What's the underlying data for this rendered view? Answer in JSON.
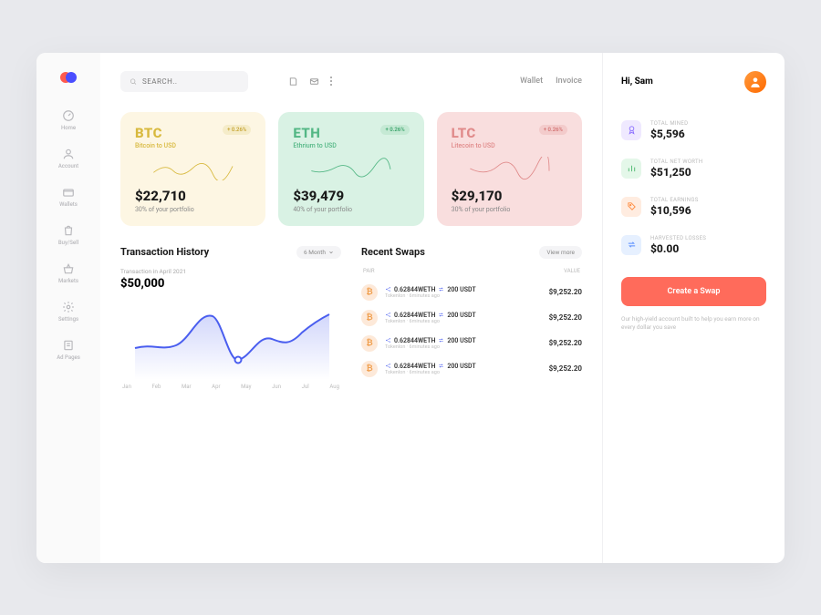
{
  "search": {
    "placeholder": "SEARCH.."
  },
  "nav": {
    "items": [
      {
        "label": "Home"
      },
      {
        "label": "Account"
      },
      {
        "label": "Wallets"
      },
      {
        "label": "Buy/Sell"
      },
      {
        "label": "Markets"
      },
      {
        "label": "Settings"
      },
      {
        "label": "Ad Pages"
      }
    ]
  },
  "top_links": {
    "wallet": "Wallet",
    "invoice": "Invoice"
  },
  "cards": [
    {
      "ticker": "BTC",
      "sub": "Bitcoin to USD",
      "change": "+ 0.26%",
      "price": "$22,710",
      "portfolio": "30% of your portfolio"
    },
    {
      "ticker": "ETH",
      "sub": "Ethrium to USD",
      "change": "+ 0.26%",
      "price": "$39,479",
      "portfolio": "40% of your portfolio"
    },
    {
      "ticker": "LTC",
      "sub": "Litecoin to USD",
      "change": "+ 0.26%",
      "price": "$29,170",
      "portfolio": "30% of your portfolio"
    }
  ],
  "history": {
    "title": "Transaction History",
    "range": "6 Month",
    "sub": "Transaction in April 2021",
    "value": "$50,000",
    "months": [
      "Jan",
      "Feb",
      "Mar",
      "Apr",
      "May",
      "Jun",
      "Jul",
      "Aug"
    ]
  },
  "swaps": {
    "title": "Recent Swaps",
    "more": "View more",
    "col_pair": "PAIR",
    "col_value": "VALUE",
    "rows": [
      {
        "pair_a": "0.62844WETH",
        "pair_b": "200 USDT",
        "sub": "Tokenlon · 6minutes ago",
        "value": "$9,252.20"
      },
      {
        "pair_a": "0.62844WETH",
        "pair_b": "200 USDT",
        "sub": "Tokenlon · 6minutes ago",
        "value": "$9,252.20"
      },
      {
        "pair_a": "0.62844WETH",
        "pair_b": "200 USDT",
        "sub": "Tokenlon · 6minutes ago",
        "value": "$9,252.20"
      },
      {
        "pair_a": "0.62844WETH",
        "pair_b": "200 USDT",
        "sub": "Tokenlon · 6minutes ago",
        "value": "$9,252.20"
      }
    ]
  },
  "right": {
    "greeting": "Hi, Sam",
    "stats": [
      {
        "label": "TOTAL MINED",
        "value": "$5,596"
      },
      {
        "label": "TOTAL NET WORTH",
        "value": "$51,250"
      },
      {
        "label": "TOTAL EARNINGS",
        "value": "$10,596"
      },
      {
        "label": "HARVESTED LOSSES",
        "value": "$0.00"
      }
    ],
    "cta": "Create a Swap",
    "cta_sub": "Our high-yield account built to help you earn more on every dollar you save"
  },
  "chart_data": {
    "type": "line",
    "title": "Transaction History",
    "xlabel": "",
    "ylabel": "",
    "x": [
      "Jan",
      "Feb",
      "Mar",
      "Apr",
      "May",
      "Jun",
      "Jul",
      "Aug"
    ],
    "values": [
      28000,
      30000,
      26000,
      52000,
      20000,
      38000,
      34000,
      48000
    ],
    "highlight": {
      "x": "May",
      "value": 20000,
      "label": "$50,000",
      "label_period": "April 2021"
    },
    "ylim": [
      15000,
      55000
    ]
  }
}
